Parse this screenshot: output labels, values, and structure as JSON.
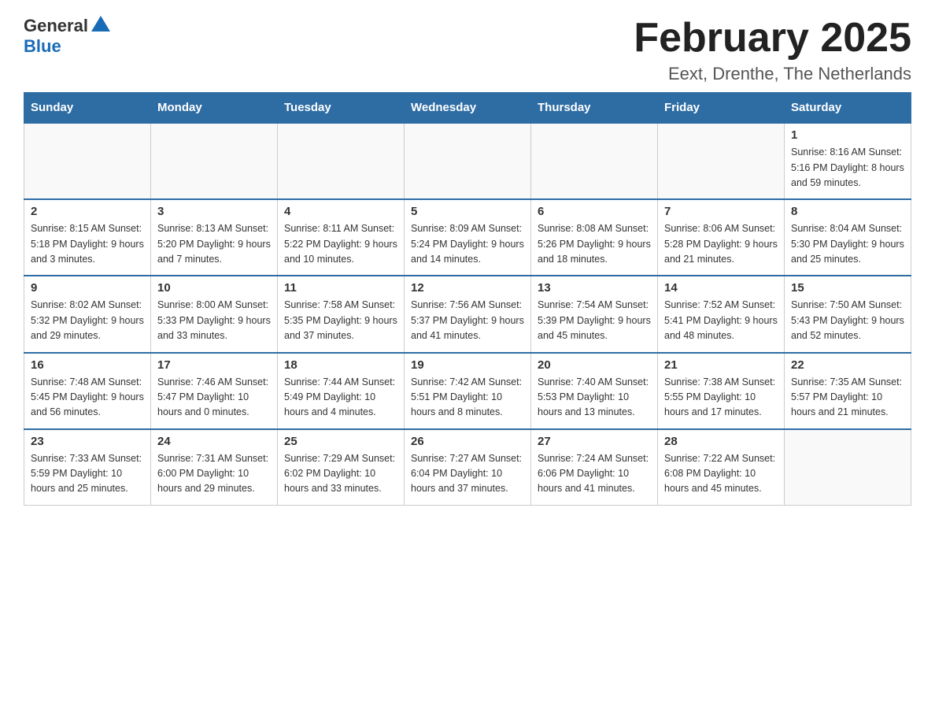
{
  "header": {
    "logo_general": "General",
    "logo_blue": "Blue",
    "title": "February 2025",
    "subtitle": "Eext, Drenthe, The Netherlands"
  },
  "days_of_week": [
    "Sunday",
    "Monday",
    "Tuesday",
    "Wednesday",
    "Thursday",
    "Friday",
    "Saturday"
  ],
  "weeks": [
    [
      {
        "day": "",
        "info": ""
      },
      {
        "day": "",
        "info": ""
      },
      {
        "day": "",
        "info": ""
      },
      {
        "day": "",
        "info": ""
      },
      {
        "day": "",
        "info": ""
      },
      {
        "day": "",
        "info": ""
      },
      {
        "day": "1",
        "info": "Sunrise: 8:16 AM\nSunset: 5:16 PM\nDaylight: 8 hours and 59 minutes."
      }
    ],
    [
      {
        "day": "2",
        "info": "Sunrise: 8:15 AM\nSunset: 5:18 PM\nDaylight: 9 hours and 3 minutes."
      },
      {
        "day": "3",
        "info": "Sunrise: 8:13 AM\nSunset: 5:20 PM\nDaylight: 9 hours and 7 minutes."
      },
      {
        "day": "4",
        "info": "Sunrise: 8:11 AM\nSunset: 5:22 PM\nDaylight: 9 hours and 10 minutes."
      },
      {
        "day": "5",
        "info": "Sunrise: 8:09 AM\nSunset: 5:24 PM\nDaylight: 9 hours and 14 minutes."
      },
      {
        "day": "6",
        "info": "Sunrise: 8:08 AM\nSunset: 5:26 PM\nDaylight: 9 hours and 18 minutes."
      },
      {
        "day": "7",
        "info": "Sunrise: 8:06 AM\nSunset: 5:28 PM\nDaylight: 9 hours and 21 minutes."
      },
      {
        "day": "8",
        "info": "Sunrise: 8:04 AM\nSunset: 5:30 PM\nDaylight: 9 hours and 25 minutes."
      }
    ],
    [
      {
        "day": "9",
        "info": "Sunrise: 8:02 AM\nSunset: 5:32 PM\nDaylight: 9 hours and 29 minutes."
      },
      {
        "day": "10",
        "info": "Sunrise: 8:00 AM\nSunset: 5:33 PM\nDaylight: 9 hours and 33 minutes."
      },
      {
        "day": "11",
        "info": "Sunrise: 7:58 AM\nSunset: 5:35 PM\nDaylight: 9 hours and 37 minutes."
      },
      {
        "day": "12",
        "info": "Sunrise: 7:56 AM\nSunset: 5:37 PM\nDaylight: 9 hours and 41 minutes."
      },
      {
        "day": "13",
        "info": "Sunrise: 7:54 AM\nSunset: 5:39 PM\nDaylight: 9 hours and 45 minutes."
      },
      {
        "day": "14",
        "info": "Sunrise: 7:52 AM\nSunset: 5:41 PM\nDaylight: 9 hours and 48 minutes."
      },
      {
        "day": "15",
        "info": "Sunrise: 7:50 AM\nSunset: 5:43 PM\nDaylight: 9 hours and 52 minutes."
      }
    ],
    [
      {
        "day": "16",
        "info": "Sunrise: 7:48 AM\nSunset: 5:45 PM\nDaylight: 9 hours and 56 minutes."
      },
      {
        "day": "17",
        "info": "Sunrise: 7:46 AM\nSunset: 5:47 PM\nDaylight: 10 hours and 0 minutes."
      },
      {
        "day": "18",
        "info": "Sunrise: 7:44 AM\nSunset: 5:49 PM\nDaylight: 10 hours and 4 minutes."
      },
      {
        "day": "19",
        "info": "Sunrise: 7:42 AM\nSunset: 5:51 PM\nDaylight: 10 hours and 8 minutes."
      },
      {
        "day": "20",
        "info": "Sunrise: 7:40 AM\nSunset: 5:53 PM\nDaylight: 10 hours and 13 minutes."
      },
      {
        "day": "21",
        "info": "Sunrise: 7:38 AM\nSunset: 5:55 PM\nDaylight: 10 hours and 17 minutes."
      },
      {
        "day": "22",
        "info": "Sunrise: 7:35 AM\nSunset: 5:57 PM\nDaylight: 10 hours and 21 minutes."
      }
    ],
    [
      {
        "day": "23",
        "info": "Sunrise: 7:33 AM\nSunset: 5:59 PM\nDaylight: 10 hours and 25 minutes."
      },
      {
        "day": "24",
        "info": "Sunrise: 7:31 AM\nSunset: 6:00 PM\nDaylight: 10 hours and 29 minutes."
      },
      {
        "day": "25",
        "info": "Sunrise: 7:29 AM\nSunset: 6:02 PM\nDaylight: 10 hours and 33 minutes."
      },
      {
        "day": "26",
        "info": "Sunrise: 7:27 AM\nSunset: 6:04 PM\nDaylight: 10 hours and 37 minutes."
      },
      {
        "day": "27",
        "info": "Sunrise: 7:24 AM\nSunset: 6:06 PM\nDaylight: 10 hours and 41 minutes."
      },
      {
        "day": "28",
        "info": "Sunrise: 7:22 AM\nSunset: 6:08 PM\nDaylight: 10 hours and 45 minutes."
      },
      {
        "day": "",
        "info": ""
      }
    ]
  ]
}
